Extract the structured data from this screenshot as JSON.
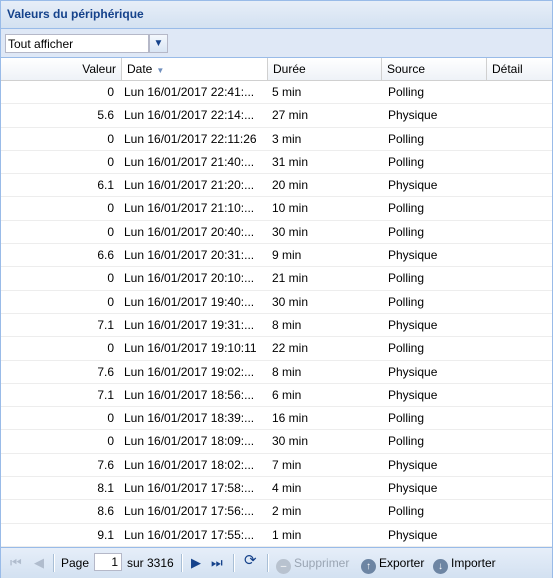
{
  "panel": {
    "title": "Valeurs du périphérique"
  },
  "filter": {
    "value": "Tout afficher"
  },
  "columns": {
    "value": "Valeur",
    "date": "Date",
    "duration": "Durée",
    "source": "Source",
    "detail": "Détail"
  },
  "rows": [
    {
      "value": "0",
      "date": "Lun 16/01/2017 22:41:...",
      "duration": "5 min",
      "source": "Polling"
    },
    {
      "value": "5.6",
      "date": "Lun 16/01/2017 22:14:...",
      "duration": "27 min",
      "source": "Physique"
    },
    {
      "value": "0",
      "date": "Lun 16/01/2017 22:11:26",
      "duration": "3 min",
      "source": "Polling"
    },
    {
      "value": "0",
      "date": "Lun 16/01/2017 21:40:...",
      "duration": "31 min",
      "source": "Polling"
    },
    {
      "value": "6.1",
      "date": "Lun 16/01/2017 21:20:...",
      "duration": "20 min",
      "source": "Physique"
    },
    {
      "value": "0",
      "date": "Lun 16/01/2017 21:10:...",
      "duration": "10 min",
      "source": "Polling"
    },
    {
      "value": "0",
      "date": "Lun 16/01/2017 20:40:...",
      "duration": "30 min",
      "source": "Polling"
    },
    {
      "value": "6.6",
      "date": "Lun 16/01/2017 20:31:...",
      "duration": "9 min",
      "source": "Physique"
    },
    {
      "value": "0",
      "date": "Lun 16/01/2017 20:10:...",
      "duration": "21 min",
      "source": "Polling"
    },
    {
      "value": "0",
      "date": "Lun 16/01/2017 19:40:...",
      "duration": "30 min",
      "source": "Polling"
    },
    {
      "value": "7.1",
      "date": "Lun 16/01/2017 19:31:...",
      "duration": "8 min",
      "source": "Physique"
    },
    {
      "value": "0",
      "date": "Lun 16/01/2017 19:10:11",
      "duration": "22 min",
      "source": "Polling"
    },
    {
      "value": "7.6",
      "date": "Lun 16/01/2017 19:02:...",
      "duration": "8 min",
      "source": "Physique"
    },
    {
      "value": "7.1",
      "date": "Lun 16/01/2017 18:56:...",
      "duration": "6 min",
      "source": "Physique"
    },
    {
      "value": "0",
      "date": "Lun 16/01/2017 18:39:...",
      "duration": "16 min",
      "source": "Polling"
    },
    {
      "value": "0",
      "date": "Lun 16/01/2017 18:09:...",
      "duration": "30 min",
      "source": "Polling"
    },
    {
      "value": "7.6",
      "date": "Lun 16/01/2017 18:02:...",
      "duration": "7 min",
      "source": "Physique"
    },
    {
      "value": "8.1",
      "date": "Lun 16/01/2017 17:58:...",
      "duration": "4 min",
      "source": "Physique"
    },
    {
      "value": "8.6",
      "date": "Lun 16/01/2017 17:56:...",
      "duration": "2 min",
      "source": "Polling"
    },
    {
      "value": "9.1",
      "date": "Lun 16/01/2017 17:55:...",
      "duration": "1 min",
      "source": "Physique"
    }
  ],
  "pager": {
    "page_label": "Page",
    "current_page": "1",
    "of_label": "sur 3316",
    "delete_label": "Supprimer",
    "export_label": "Exporter",
    "import_label": "Importer"
  },
  "icons": {
    "first": "first-page-icon",
    "prev": "prev-page-icon",
    "next": "next-page-icon",
    "last": "last-page-icon",
    "refresh": "refresh-icon",
    "delete": "delete-icon",
    "export": "cloud-export-icon",
    "import": "cloud-import-icon",
    "dropdown": "chevron-down-icon",
    "sort": "sort-desc-icon"
  },
  "colors": {
    "header_text": "#15428b",
    "border": "#99bbe8"
  }
}
